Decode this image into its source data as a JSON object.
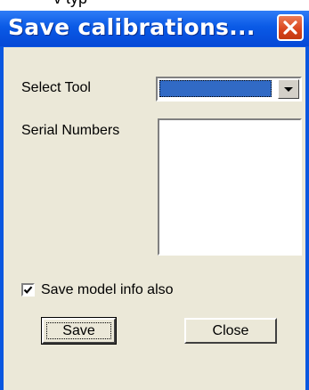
{
  "window": {
    "title": "Save calibrations...",
    "partial_top_text": "v typ"
  },
  "form": {
    "select_tool_label": "Select Tool",
    "select_tool_value": "",
    "serial_numbers_label": "Serial Numbers",
    "serial_numbers_items": [],
    "save_model_info_label": "Save model info also",
    "save_model_info_checked": true
  },
  "buttons": {
    "save": "Save",
    "close": "Close"
  },
  "icons": {
    "close": "close-x-icon",
    "dropdown": "chevron-down-icon",
    "checkbox": "checkmark-icon"
  },
  "colors": {
    "titlebar": "#0a5ae6",
    "close_button": "#d9441c",
    "client_bg": "#ebe8d8",
    "selection": "#316ac5"
  }
}
